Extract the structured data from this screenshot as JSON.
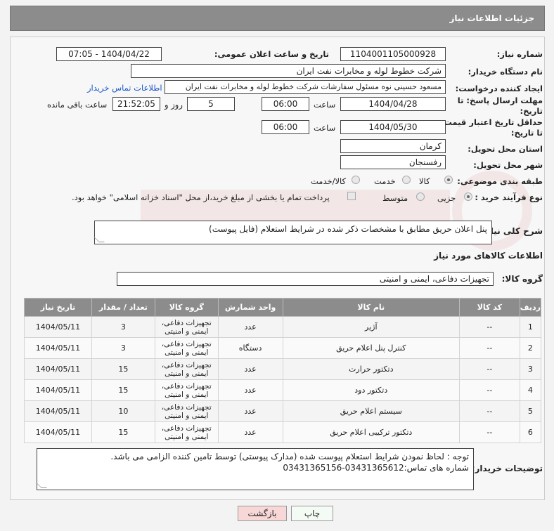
{
  "header": {
    "title": "جزئیات اطلاعات نیاز"
  },
  "form": {
    "need_number_label": "شماره نیاز:",
    "need_number": "1104001105000928",
    "announce_label": "تاریخ و ساعت اعلان عمومی:",
    "announce_value": "1404/04/22 - 07:05",
    "buyer_org_label": "نام دستگاه خریدار:",
    "buyer_org": "شرکت خطوط لوله و مخابرات نفت ایران",
    "creator_label": "ایجاد کننده درخواست:",
    "creator": "مسعود حسینی نوه  مسئول سفارشات  شرکت خطوط لوله و مخابرات نفت ایران",
    "contact_link": "اطلاعات تماس خریدار",
    "deadline_label_1": "مهلت ارسال پاسخ: تا",
    "deadline_label_2": "تاریخ:",
    "deadline_date": "1404/04/28",
    "time_label": "ساعت",
    "deadline_time": "06:00",
    "days_value": "5",
    "days_label": "روز و",
    "remaining_time": "21:52:05",
    "remaining_label": "ساعت باقی مانده",
    "validity_label_1": "حداقل تاریخ اعتبار قیمت:",
    "validity_label_2": "تا تاریخ:",
    "validity_date": "1404/05/30",
    "validity_time": "06:00",
    "province_label": "استان محل تحویل:",
    "province": "کرمان",
    "city_label": "شهر محل تحویل:",
    "city": "رفسنجان",
    "category_label": "طبقه بندی موضوعی:",
    "category_options": [
      "کالا",
      "خدمت",
      "کالا/خدمت"
    ],
    "process_label": "نوع فرآیند خرید :",
    "process_options": [
      "جزیی",
      "متوسط"
    ],
    "payment_note": "پرداخت تمام یا بخشی از مبلغ خرید،از محل \"اسناد خزانه اسلامی\" خواهد بود.",
    "summary_label": "شرح کلی نیاز:",
    "summary": "پنل اعلان حریق مطابق با مشخصات ذکر شده در شرایط استعلام (فایل پیوست)",
    "goods_info_title": "اطلاعات کالاهای مورد نیاز",
    "goods_group_label": "گروه کالا:",
    "goods_group": "تجهیزات دفاعی، ایمنی و امنیتی"
  },
  "table": {
    "headers": [
      "ردیف",
      "کد کالا",
      "نام کالا",
      "واحد شمارش",
      "گروه کالا",
      "تعداد / مقدار",
      "تاریخ نیاز"
    ],
    "rows": [
      [
        "1",
        "--",
        "آژیر",
        "عدد",
        "تجهیزات دفاعی، ایمنی و امنیتی",
        "3",
        "1404/05/11"
      ],
      [
        "2",
        "--",
        "کنترل پنل اعلام حریق",
        "دستگاه",
        "تجهیزات دفاعی، ایمنی و امنیتی",
        "3",
        "1404/05/11"
      ],
      [
        "3",
        "--",
        "دتکتور حرارت",
        "عدد",
        "تجهیزات دفاعی، ایمنی و امنیتی",
        "15",
        "1404/05/11"
      ],
      [
        "4",
        "--",
        "دتکتور دود",
        "عدد",
        "تجهیزات دفاعی، ایمنی و امنیتی",
        "15",
        "1404/05/11"
      ],
      [
        "5",
        "--",
        "سیستم اعلام حریق",
        "عدد",
        "تجهیزات دفاعی، ایمنی و امنیتی",
        "10",
        "1404/05/11"
      ],
      [
        "6",
        "--",
        "دتکتور ترکیبی اعلام حریق",
        "عدد",
        "تجهیزات دفاعی، ایمنی و امنیتی",
        "15",
        "1404/05/11"
      ]
    ]
  },
  "notes": {
    "label": "توضیحات خریدار:",
    "line1": "توجه : لحاظ نمودن شرایط استعلام پیوست شده (مدارک پیوستی) توسط تامین کننده الزامی می باشد.",
    "line2": "شماره های تماس:03431365612-03431365156"
  },
  "buttons": {
    "print": "چاپ",
    "back": "بازگشت"
  },
  "colors": {
    "header_bg": "#8c8c8c",
    "link": "#1a57c7",
    "back_button_bg": "#f8d7d7"
  }
}
